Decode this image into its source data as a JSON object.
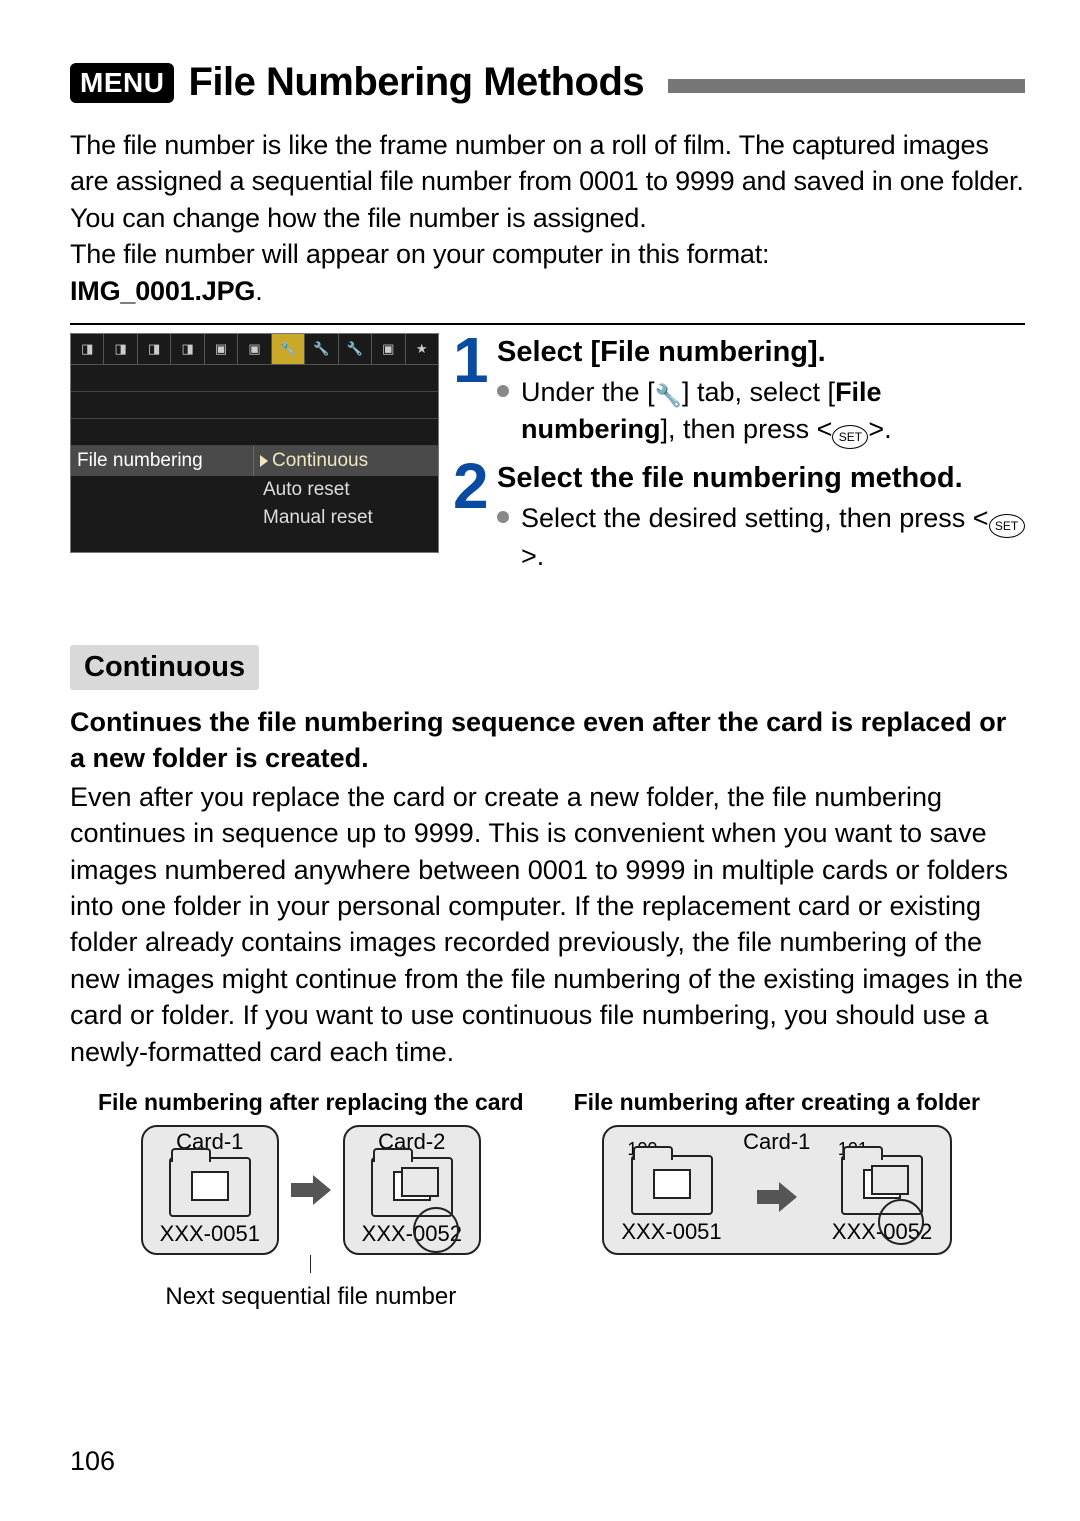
{
  "header": {
    "menu_badge": "MENU",
    "title": "File Numbering Methods"
  },
  "intro": {
    "p1": "The file number is like the frame number on a roll of film. The captured images are assigned a sequential file number from 0001 to 9999 and saved in one folder. You can change how the file number is assigned.",
    "p2": "The file number will appear on your computer in this format: ",
    "filename": "IMG_0001.JPG"
  },
  "camera_menu": {
    "label": "File numbering",
    "selected": "Continuous",
    "options": [
      "Continuous",
      "Auto reset",
      "Manual reset"
    ]
  },
  "steps": [
    {
      "num": "1",
      "head": "Select [File numbering].",
      "bullet1_a": "Under the [",
      "bullet1_b": "] tab, select [",
      "bullet1_c": "File numbering",
      "bullet1_d": "], then press <",
      "bullet1_e": ">.",
      "set_label": "SET"
    },
    {
      "num": "2",
      "head": "Select the file numbering method.",
      "bullet1_a": "Select the desired setting, then press <",
      "bullet1_b": ">.",
      "set_label": "SET"
    }
  ],
  "continuous": {
    "label": "Continuous",
    "bold": "Continues the file numbering sequence even after the card is replaced or a new folder is created.",
    "body": "Even after you replace the card or create a new folder, the file numbering continues in sequence up to 9999. This is convenient when you want to save images numbered anywhere between 0001 to 9999 in multiple cards or folders into one folder in your personal computer. If the replacement card or existing folder already contains images recorded previously, the file numbering of the new images might continue from the file numbering of the existing images in the card or folder. If you want to use continuous file numbering, you should use a newly-formatted card each time."
  },
  "diagrams": {
    "left": {
      "title": "File numbering after replacing the card",
      "card1": "Card-1",
      "card2": "Card-2",
      "file1": "XXX-0051",
      "file2": "XXX-0052",
      "caption": "Next sequential file number"
    },
    "right": {
      "title": "File numbering after creating a folder",
      "card": "Card-1",
      "folder1": "100",
      "folder2": "101",
      "file1": "XXX-0051",
      "file2": "XXX-0052"
    }
  },
  "page_number": "106"
}
